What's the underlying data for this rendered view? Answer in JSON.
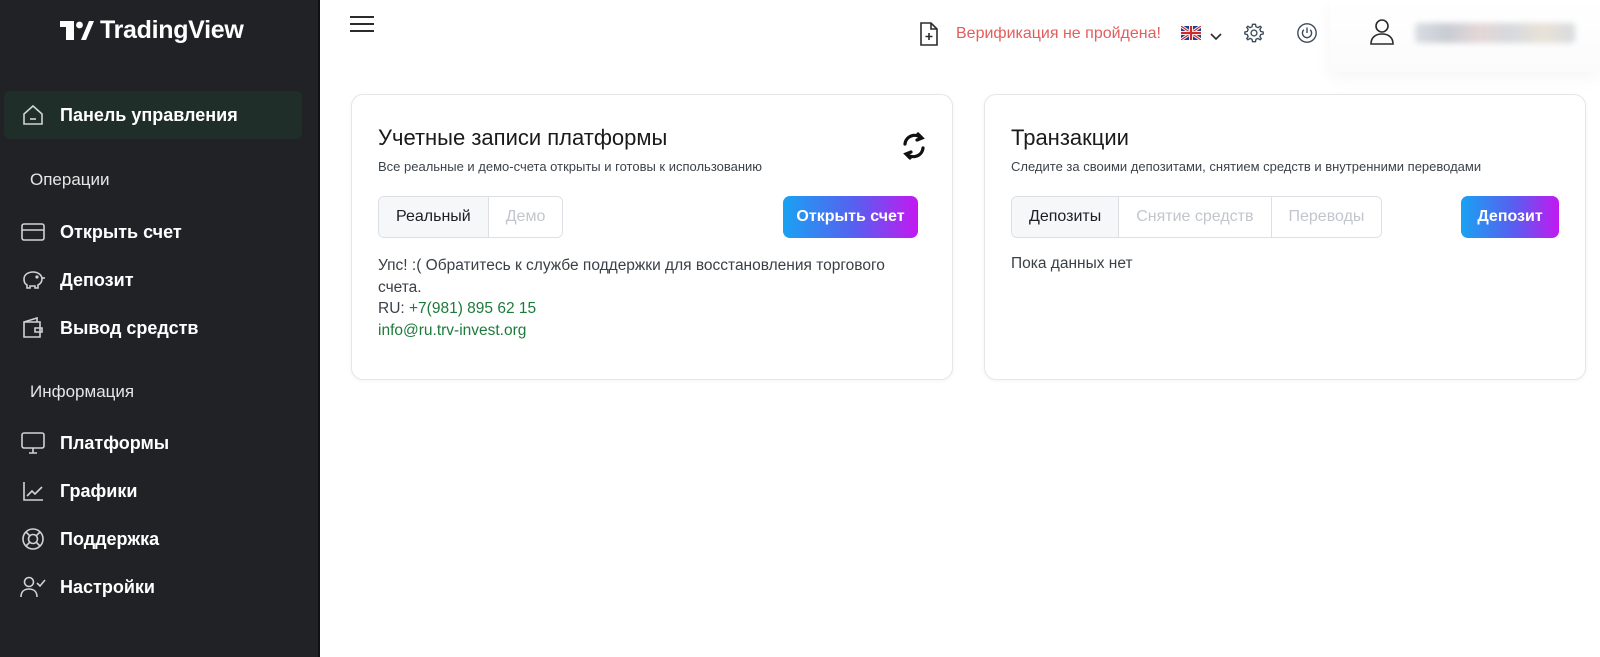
{
  "brand": {
    "name": "TradingView"
  },
  "sidebar": {
    "dashboard_label": "Панель управления",
    "section_operations": "Операции",
    "open_account_label": "Открыть счет",
    "deposit_label": "Депозит",
    "withdraw_label": "Вывод средств",
    "section_info": "Информация",
    "platforms_label": "Платформы",
    "charts_label": "Графики",
    "support_label": "Поддержка",
    "settings_label": "Настройки"
  },
  "header": {
    "verification_status": "Верификация не пройдена!",
    "language": "en-GB flag"
  },
  "accounts_card": {
    "title": "Учетные записи платформы",
    "subtitle": "Все реальные и демо-счета открыты и готовы к использованию",
    "tab_real": "Реальный",
    "tab_demo": "Демо",
    "open_button": "Открыть счет",
    "message": "Упс! :( Обратитесь к службе поддержки для восстановления торгового счета.",
    "phone_prefix": "RU: ",
    "phone": "+7(981) 895 62 15",
    "email": "info@ru.trv-invest.org"
  },
  "transactions_card": {
    "title": "Транзакции",
    "subtitle": "Следите за своими депозитами, снятием средств и внутренними переводами",
    "tab_deposits": "Депозиты",
    "tab_withdrawals": "Снятие средств",
    "tab_transfers": "Переводы",
    "deposit_button": "Депозит",
    "empty_text": "Пока данных нет"
  },
  "colors": {
    "sidebar_bg": "#202225",
    "active_item_bg": "#1f2e28",
    "verification_red": "#e35d5d",
    "link_green": "#1e7a3c",
    "button_gradient": [
      "#1aa2f2",
      "#5a5df0",
      "#c418f0"
    ]
  }
}
